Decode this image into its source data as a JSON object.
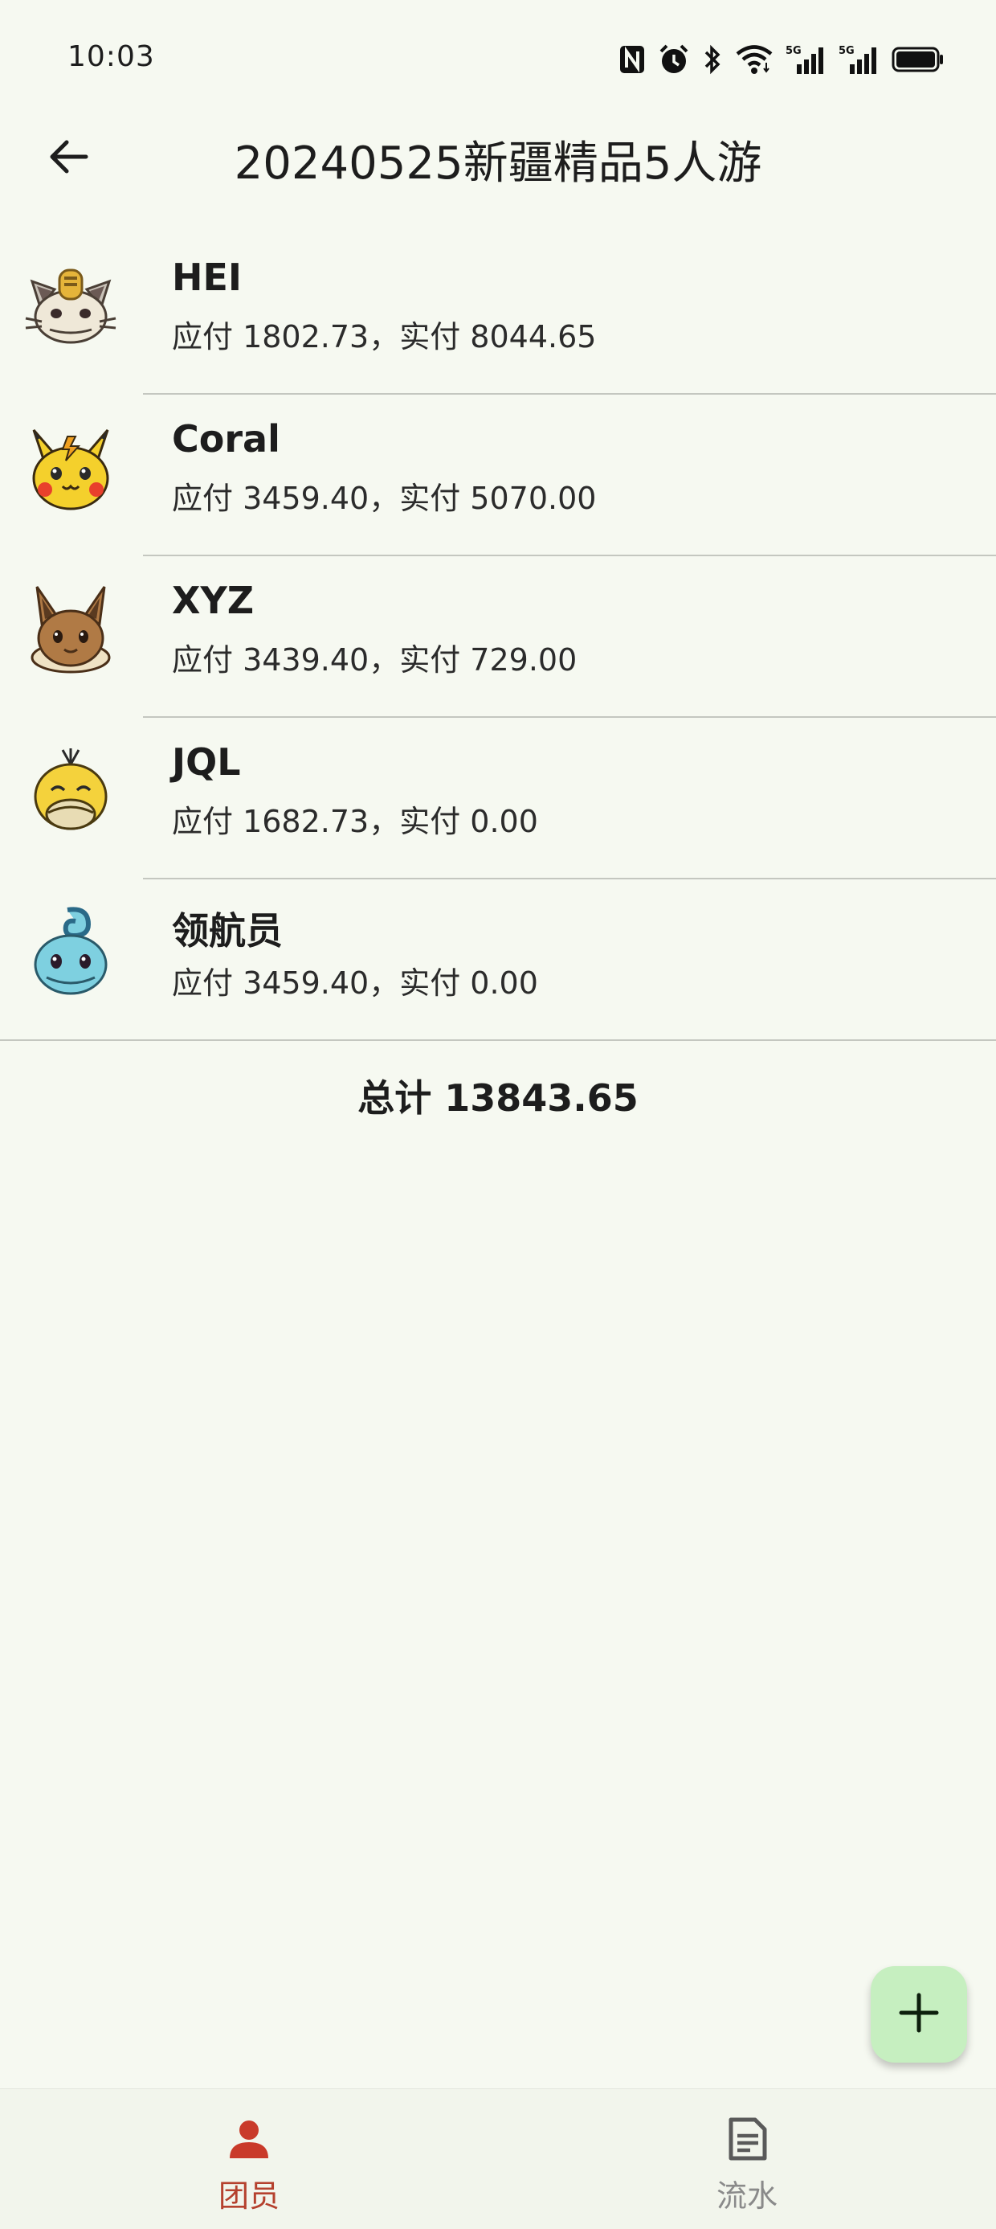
{
  "status_bar": {
    "time": "10:03",
    "icons": [
      "nfc-icon",
      "alarm-icon",
      "bluetooth-icon",
      "wifi-icon",
      "5g-signal-icon",
      "5g-signal-icon",
      "battery-icon"
    ],
    "network_label_1": "5G",
    "network_label_2": "5G"
  },
  "app_bar": {
    "back_icon": "arrow-left-icon",
    "title": "20240525新疆精品5人游"
  },
  "members": [
    {
      "name": "HEI",
      "amounts": "应付 1802.73，实付 8044.65",
      "avatar": "meowth-avatar"
    },
    {
      "name": "Coral",
      "amounts": "应付 3459.40，实付 5070.00",
      "avatar": "pikachu-avatar"
    },
    {
      "name": "XYZ",
      "amounts": "应付 3439.40，实付 729.00",
      "avatar": "eevee-avatar"
    },
    {
      "name": "JQL",
      "amounts": "应付 1682.73，实付 0.00",
      "avatar": "psyduck-avatar"
    },
    {
      "name": "领航员",
      "amounts": "应付 3459.40，实付 0.00",
      "avatar": "squirtle-avatar"
    }
  ],
  "total": {
    "text": "总计 13843.65"
  },
  "fab": {
    "icon": "plus-icon"
  },
  "bottom_nav": {
    "items": [
      {
        "label": "团员",
        "icon": "person-icon",
        "active": true
      },
      {
        "label": "流水",
        "icon": "document-icon",
        "active": false
      }
    ]
  },
  "colors": {
    "background": "#f6f9f1",
    "accent_active": "#b5412e",
    "fab": "#c6efc0",
    "divider": "#c4c7c0"
  }
}
